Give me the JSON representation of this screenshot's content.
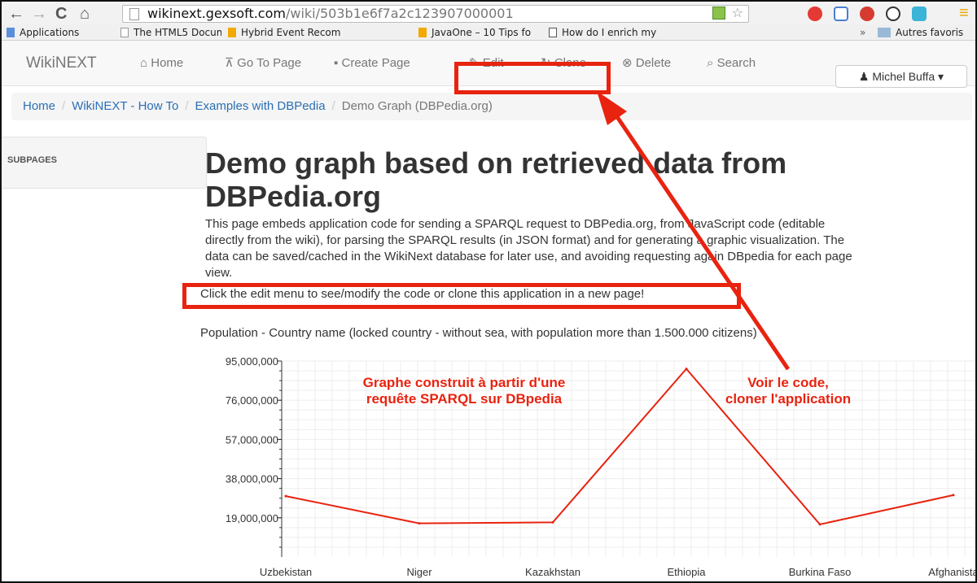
{
  "browser": {
    "url_host": "wikinext.gexsoft.com",
    "url_path": "/wiki/503b1e6f7a2c123907000001",
    "bookmarks": [
      "Applications",
      "The HTML5 Docume",
      "Hybrid Event Recom",
      "JavaOne – 10 Tips fo",
      "How do I enrich my"
    ],
    "other_bookmarks": "Autres favoris",
    "overflow": "»"
  },
  "navbar": {
    "brand": "WikiNEXT",
    "items": [
      "Home",
      "Go To Page",
      "Create Page",
      "Edit",
      "Clone",
      "Delete",
      "Search"
    ],
    "user": "Michel Buffa"
  },
  "breadcrumb": {
    "items": [
      "Home",
      "WikiNEXT - How To",
      "Examples with DBPedia"
    ],
    "current": "Demo Graph (DBPedia.org)"
  },
  "sidebar": {
    "label": "SUBPAGES"
  },
  "main": {
    "title": "Demo graph based on retrieved data from DBPedia.org",
    "intro": "This page embeds application code for sending a SPARQL request to DBPedia.org, from JavaScript code (editable directly from the wiki), for parsing the SPARQL results (in JSON format) and for generating a graphic visualization. The data can be saved/cached in the WikiNext database for later use, and avoiding requesting again DBpedia for each page view.",
    "cta": "Click the edit menu to see/modify the code or clone this application in a new page!",
    "chart_caption": "Population - Country name (locked country - without sea, with population more than 1.500.000 citizens)"
  },
  "annotations": {
    "left": [
      "Graphe construit à partir d'une",
      "requête SPARQL sur DBpedia"
    ],
    "right": [
      "Voir le code,",
      "cloner l'application"
    ]
  },
  "colors": {
    "annotation": "#e8230f",
    "link": "#2a6fb5",
    "line": "#e8230f"
  },
  "chart_data": {
    "type": "line",
    "categories": [
      "Uzbekistan",
      "Niger",
      "Kazakhstan",
      "Ethiopia",
      "Burkina Faso",
      "Afghanistan"
    ],
    "tick_labels": [
      "Uzbekistan",
      "Niger",
      "Kazakhstan",
      "Ethiopia",
      "Burkina Faso",
      "Afghanista"
    ],
    "values": [
      29500000,
      16300000,
      16800000,
      91200000,
      15800000,
      30000000
    ],
    "yticks": [
      "95,000,000",
      "76,000,000",
      "57,000,000",
      "38,000,000",
      "19,000,000"
    ],
    "ytick_values": [
      95000000,
      76000000,
      57000000,
      38000000,
      19000000
    ],
    "ylim": [
      0,
      95000000
    ],
    "grid": true
  }
}
